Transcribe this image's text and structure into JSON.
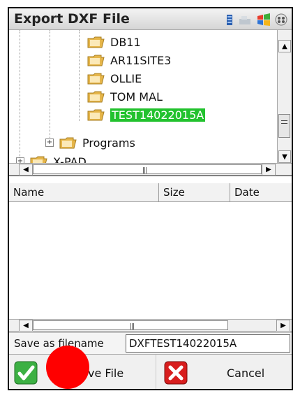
{
  "window": {
    "title": "Export DXF File"
  },
  "status_icons": [
    "signal-icon",
    "connection-icon",
    "windows-start-icon",
    "keyboard-icon"
  ],
  "tree": {
    "items": [
      {
        "label": "DB11",
        "selected": false
      },
      {
        "label": "AR11SITE3",
        "selected": false
      },
      {
        "label": "OLLIE",
        "selected": false
      },
      {
        "label": "TOM MAL",
        "selected": false
      },
      {
        "label": "TEST14022015A",
        "selected": true
      },
      {
        "label": "Programs",
        "expander": "+"
      },
      {
        "label": "X-PAD",
        "expander": "+"
      }
    ]
  },
  "file_list": {
    "columns": [
      "Name",
      "Size",
      "Date"
    ]
  },
  "save": {
    "label": "Save as filename",
    "value": "DXFTEST14022015A"
  },
  "buttons": {
    "save_label": "ve File",
    "cancel_label": "Cancel"
  },
  "colors": {
    "selection": "#22c22e",
    "confirm_green": "#3cb043",
    "cancel_red": "#d81e1e",
    "overlay_red": "#ff0000"
  }
}
